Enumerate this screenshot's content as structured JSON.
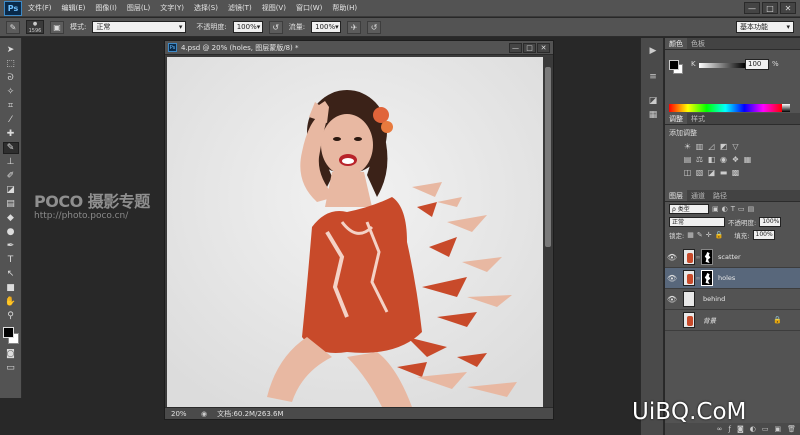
{
  "app": {
    "logo": "Ps"
  },
  "menu": [
    "文件(F)",
    "编辑(E)",
    "图像(I)",
    "图层(L)",
    "文字(Y)",
    "选择(S)",
    "滤镜(T)",
    "视图(V)",
    "窗口(W)",
    "帮助(H)"
  ],
  "window_controls": [
    "—",
    "□",
    "✕"
  ],
  "options": {
    "brush_size": "1596",
    "mode_label": "模式:",
    "mode_value": "正常",
    "opacity_label": "不透明度:",
    "opacity_value": "100%",
    "flow_label": "流量:",
    "flow_value": "100%",
    "workspace": "基本功能"
  },
  "watermark": {
    "title": "POCO 摄影专题",
    "url": "http://photo.poco.cn/"
  },
  "document": {
    "title": "4.psd @ 20% (holes, 图层蒙版/8) *",
    "zoom": "20%",
    "doc_info": "文档:60.2M/263.6M"
  },
  "color_panel": {
    "tabs": [
      "颜色",
      "色板"
    ],
    "channel": "K",
    "value": "100",
    "unit": "%"
  },
  "adjust_panel": {
    "tabs": [
      "调整",
      "样式"
    ],
    "title": "添加调整"
  },
  "layers_panel": {
    "tabs": [
      "图层",
      "通道",
      "路径"
    ],
    "filter": "ρ 类型",
    "blend_mode": "正常",
    "opacity_label": "不透明度:",
    "opacity": "100%",
    "lock_label": "锁定:",
    "fill_label": "填充:",
    "fill": "100%",
    "layers": [
      {
        "name": "scatter",
        "visible": true,
        "has_mask": true,
        "selected": false
      },
      {
        "name": "holes",
        "visible": true,
        "has_mask": true,
        "selected": true
      },
      {
        "name": "behind",
        "visible": true,
        "has_mask": false,
        "selected": false
      },
      {
        "name": "背景",
        "visible": false,
        "has_mask": false,
        "selected": false,
        "locked": true
      }
    ]
  },
  "brand": "UiBQ.CoM",
  "colors": {
    "chrome": "#535353",
    "workspace": "#282828",
    "selected_layer": "#58677b",
    "dress": "#c84a2a"
  }
}
